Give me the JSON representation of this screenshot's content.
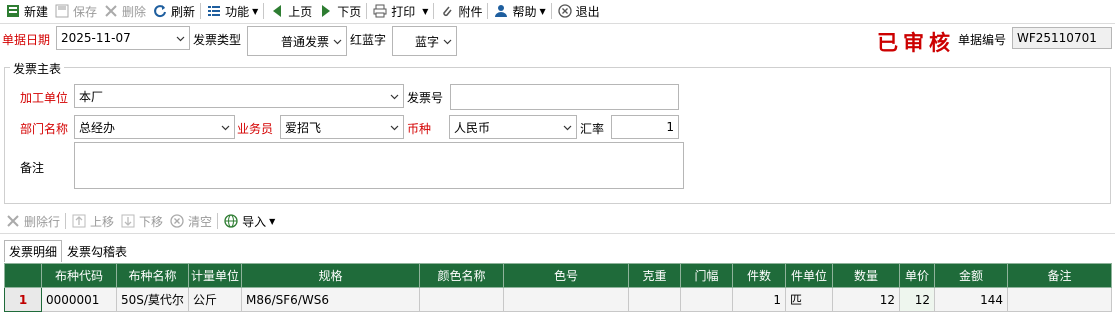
{
  "toolbar": {
    "new": "新建",
    "save": "保存",
    "delete": "删除",
    "refresh": "刷新",
    "function": "功能",
    "prev": "上页",
    "next": "下页",
    "print": "打印",
    "attach": "附件",
    "help": "帮助",
    "exit": "退出"
  },
  "header": {
    "date_label": "单据日期",
    "date_value": "2025-11-07",
    "type_label": "发票类型",
    "type_value": "普通发票",
    "redblue_label": "红蓝字",
    "redblue_value": "蓝字",
    "status_stamp": "已审核",
    "docno_label": "单据编号",
    "docno_value": "WF25110701"
  },
  "invoice": {
    "group_title": "发票主表",
    "unit_label": "加工单位",
    "unit_value": "本厂",
    "invno_label": "发票号",
    "invno_value": "",
    "dept_label": "部门名称",
    "dept_value": "总经办",
    "sales_label": "业务员",
    "sales_value": "爱招飞",
    "currency_label": "币种",
    "currency_value": "人民币",
    "rate_label": "汇率",
    "rate_value": "1",
    "remark_label": "备注",
    "remark_value": ""
  },
  "detail_toolbar": {
    "delete_row": "删除行",
    "move_up": "上移",
    "move_down": "下移",
    "clear": "清空",
    "import": "导入"
  },
  "tabs": [
    "发票明细",
    "发票勾稽表"
  ],
  "grid": {
    "headers": [
      "",
      "布种代码",
      "布种名称",
      "计量单位",
      "规格",
      "颜色名称",
      "色号",
      "克重",
      "门幅",
      "件数",
      "件单位",
      "数量",
      "单价",
      "金额",
      "备注"
    ],
    "rows": [
      [
        "1",
        "0000001",
        "50S/莫代尔",
        "公斤",
        "M86/SF6/WS6",
        "",
        "",
        "",
        "",
        "1",
        "匹",
        "12",
        "12",
        "144",
        ""
      ]
    ]
  },
  "colors": {
    "header_green": "#1f6b3a",
    "required_red": "#d40000",
    "stamp_red": "#cc0000"
  }
}
